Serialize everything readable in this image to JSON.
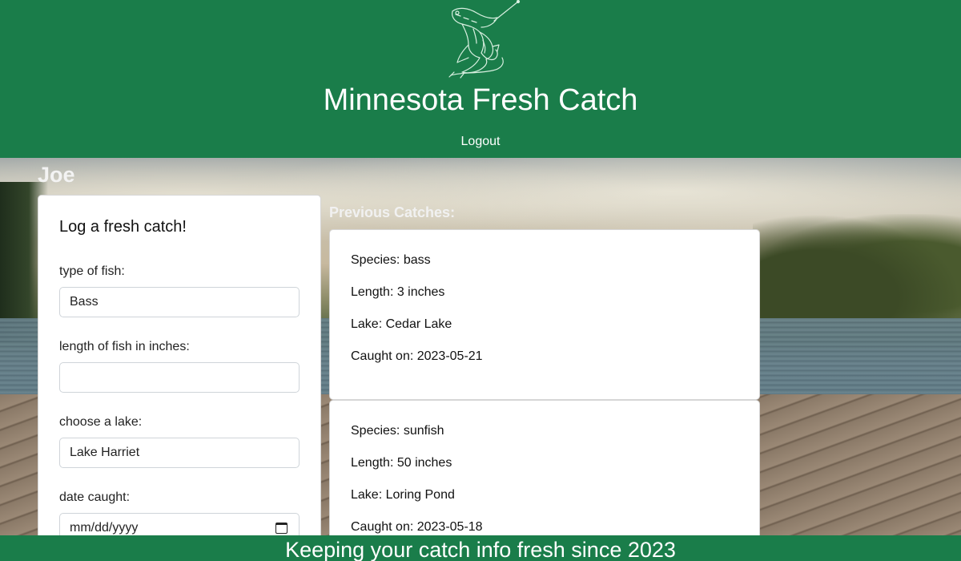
{
  "header": {
    "title": "Minnesota Fresh Catch",
    "logout_label": "Logout",
    "logo_icon": "fish-logo-icon",
    "bg_color": "#1a7d4a"
  },
  "user": {
    "name": "Joe"
  },
  "form": {
    "title": "Log a fresh catch!",
    "fish_label": "type of fish:",
    "fish_value": "Bass",
    "length_label": "length of fish in inches:",
    "length_value": "",
    "lake_label": "choose a lake:",
    "lake_value": "Lake Harriet",
    "date_label": "date caught:",
    "date_value": "mm/dd/yyyy",
    "date_icon": "calendar-icon"
  },
  "previous": {
    "heading": "Previous Catches:",
    "catches": [
      {
        "species": "Species: bass",
        "length": "Length: 3 inches",
        "lake": "Lake: Cedar Lake",
        "date": "Caught on: 2023-05-21"
      },
      {
        "species": "Species: sunfish",
        "length": "Length: 50 inches",
        "lake": "Lake: Loring Pond",
        "date": "Caught on: 2023-05-18"
      }
    ]
  },
  "footer": {
    "text": "Keeping your catch info fresh since 2023"
  }
}
